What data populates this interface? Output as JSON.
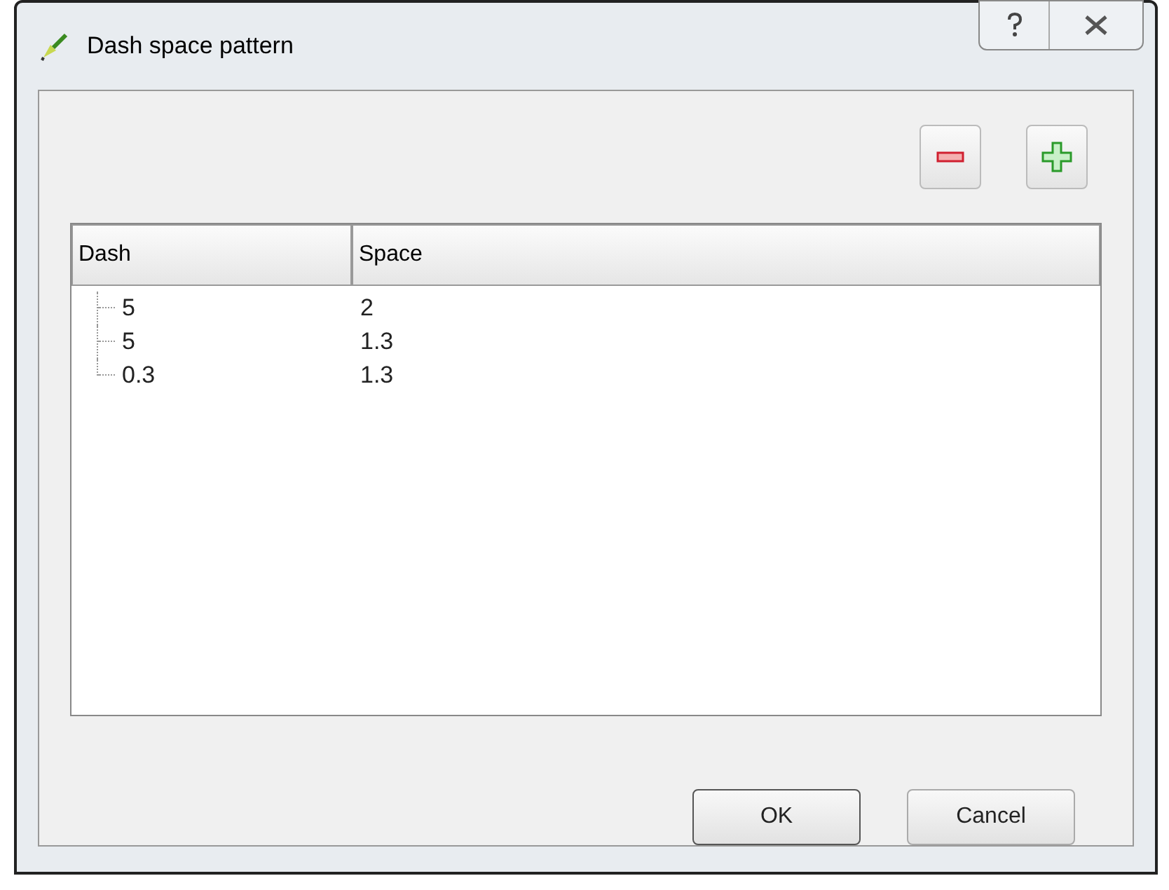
{
  "window": {
    "title": "Dash space pattern"
  },
  "table": {
    "columns": [
      "Dash",
      "Space"
    ],
    "rows": [
      {
        "dash": "5",
        "space": "2"
      },
      {
        "dash": "5",
        "space": "1.3"
      },
      {
        "dash": "0.3",
        "space": "1.3"
      }
    ]
  },
  "buttons": [
    "OK",
    "Cancel"
  ]
}
